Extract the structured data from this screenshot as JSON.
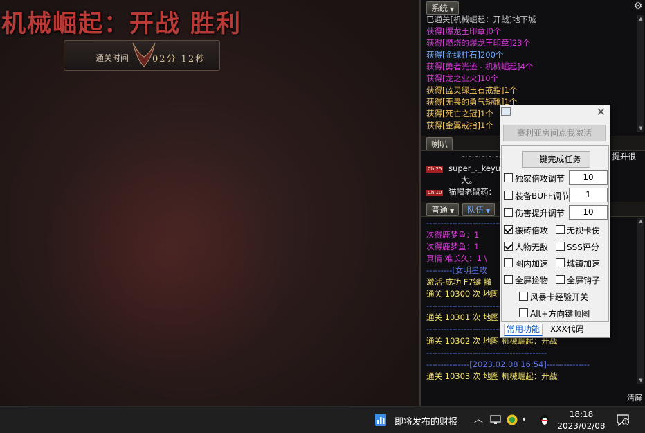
{
  "game": {
    "title": "机械崛起：开战 胜利",
    "timer_label": "通关时间",
    "timer_value": "02分 12秒"
  },
  "system_panel": {
    "tab_label": "系统",
    "lines": [
      {
        "text": "已通关[机械崛起：开战]地下城",
        "color": "grey"
      },
      {
        "text": "获得[爆龙王印章]0个",
        "color": "mag"
      },
      {
        "text": "获得[燃烧的爆龙王印章]23个",
        "color": "mag"
      },
      {
        "text": "获得[金绿柱石]200个",
        "color": "lblue"
      },
      {
        "text": "获得[勇者光迹 - 机械崛起]4个",
        "color": "mag"
      },
      {
        "text": "获得[龙之业火]10个",
        "color": "mag"
      },
      {
        "text": "获得[蓝灵绿玉石戒指]1个",
        "color": "gold"
      },
      {
        "text": "获得[无畏的勇气短靴]1个",
        "color": "gold"
      },
      {
        "text": "获得[死亡之冠]1个",
        "color": "gold"
      },
      {
        "text": "获得[金翼戒指]1个",
        "color": "gold"
      }
    ]
  },
  "horn_panel": {
    "tab_label": "喇叭",
    "lines": [
      {
        "badge": "",
        "text": "~~~~~~~~~~",
        "suffix": "提升很"
      },
      {
        "badge": "Ch.25",
        "text": "super_._keyu",
        "suffix": ""
      },
      {
        "badge": "",
        "text": "大。",
        "suffix": ""
      },
      {
        "badge": "Ch.10",
        "text": "猫喝老鼠药：",
        "suffix": ""
      }
    ]
  },
  "chat_panel": {
    "tab_normal": "普通",
    "tab_team": "队伍",
    "lines": [
      {
        "text": "------------------------------------------",
        "color": "blue"
      },
      {
        "text": "次得鹿梦鱼：1",
        "color": "mag"
      },
      {
        "text": "次得鹿梦鱼：1",
        "color": "mag"
      },
      {
        "text": "真情·难长久：1 \\",
        "color": "mag"
      },
      {
        "text": "---------[女明星攻",
        "color": "blue"
      },
      {
        "text": "激活-成功  F7键 撤",
        "color": "yel"
      },
      {
        "text": "通关 10300 次 地图",
        "color": "yel"
      },
      {
        "text": "------------------------------------------",
        "color": "blue"
      },
      {
        "text": "通关 10301 次 地图",
        "color": "yel"
      },
      {
        "text": "------------------------------------------",
        "color": "blue"
      },
      {
        "text": "通关 10302 次 地图 机械崛起：开战",
        "color": "yel"
      },
      {
        "text": "------------------------------------------",
        "color": "blue"
      },
      {
        "text": "---------------[2023.02.08 16:54]---------------",
        "color": "blue"
      },
      {
        "text": "通关 10303 次 地图 机械崛起：开战",
        "color": "yel"
      }
    ],
    "clear_label": "清屏"
  },
  "dialog": {
    "activate_label": "赛利亚房间点我激活",
    "complete_label": "一键完成任务",
    "rows": [
      {
        "label": "独家倍攻调节",
        "value": "10",
        "checked": false
      },
      {
        "label": "装备BUFF调节",
        "value": "1",
        "checked": false
      },
      {
        "label": "伤害提升调节",
        "value": "10",
        "checked": false
      }
    ],
    "checks": [
      {
        "label": "搬砖倍攻",
        "checked": true
      },
      {
        "label": "无视卡伤",
        "checked": false
      },
      {
        "label": "人物无敌",
        "checked": true
      },
      {
        "label": "SSS评分",
        "checked": false
      },
      {
        "label": "图内加速",
        "checked": false
      },
      {
        "label": "城镇加速",
        "checked": false
      },
      {
        "label": "全屏捡物",
        "checked": false
      },
      {
        "label": "全屏钩子",
        "checked": false
      }
    ],
    "wide_checks": [
      {
        "label": "风暴卡经验开关",
        "checked": false
      },
      {
        "label": "Alt+方向键顺图",
        "checked": false
      }
    ],
    "tab_active": "常用功能",
    "tab_other": "XXX代码"
  },
  "taskbar": {
    "news_label": "即将发布的财报",
    "time": "18:18",
    "date": "2023/02/08",
    "notif_count": "1"
  },
  "colors": {
    "magenta": "#d63ad6",
    "gold": "#f2c35a",
    "light_blue": "#6fa9ff",
    "yellow": "#f4e36c",
    "title_red": "#b83a36"
  }
}
